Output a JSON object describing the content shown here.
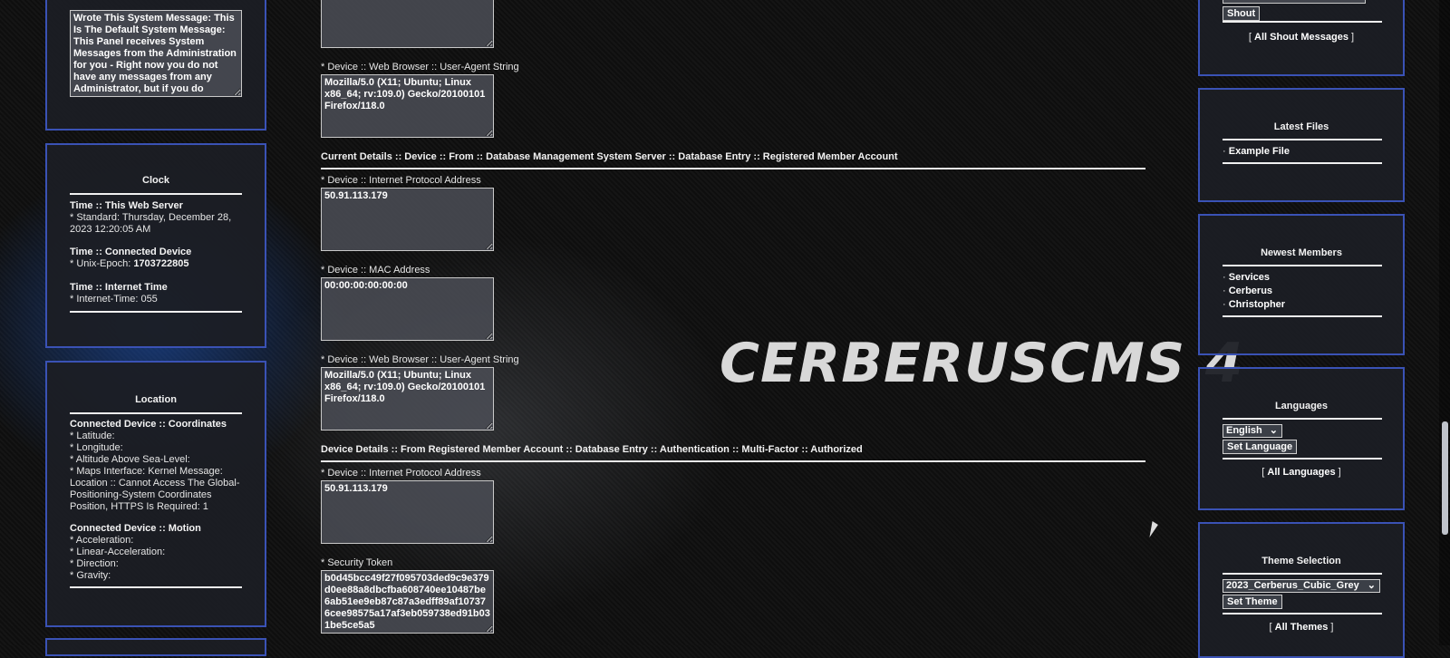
{
  "left": {
    "system_message_text": "Wrote This System Message: This Is The Default System Message: This Panel receives System Messages from the Administration for you - Right now you do not have any messages from any Administrator, but if you do",
    "clock": {
      "title": "Clock",
      "server_heading": "Time :: This Web Server",
      "server_value": "* Standard: Thursday, December 28, 2023 12:20:05 AM",
      "device_heading": "Time :: Connected Device",
      "device_label": "* Unix-Epoch: ",
      "device_value": "1703722805",
      "internet_heading": "Time :: Internet Time",
      "internet_value": "* Internet-Time: 055"
    },
    "location": {
      "title": "Location",
      "coords_heading": "Connected Device :: Coordinates",
      "latitude": "* Latitude:",
      "longitude": "* Longitude:",
      "altitude": "* Altitude Above Sea-Level:",
      "maps_message": "* Maps Interface: Kernel Message: Location :: Cannot Access The Global-Positioning-System Coordinates Position, HTTPS Is Required: 1",
      "motion_heading": "Connected Device :: Motion",
      "acceleration": "* Acceleration:",
      "linear_acceleration": "* Linear-Acceleration:",
      "direction": "* Direction:",
      "gravity": "* Gravity:"
    }
  },
  "main": {
    "ua_label_1": "* Device :: Web Browser :: User-Agent String",
    "ua_value_1": "Mozilla/5.0 (X11; Ubuntu; Linux x86_64; rv:109.0) Gecko/20100101 Firefox/118.0",
    "current_heading": "Current Details :: Device :: From :: Database Management System Server :: Database Entry :: Registered Member Account",
    "ip_label_1": "* Device :: Internet Protocol Address",
    "ip_value_1": "50.91.113.179",
    "mac_label": "* Device :: MAC Address",
    "mac_value": "00:00:00:00:00:00",
    "ua_label_2": "* Device :: Web Browser :: User-Agent String",
    "ua_value_2": "Mozilla/5.0 (X11; Ubuntu; Linux x86_64; rv:109.0) Gecko/20100101 Firefox/118.0",
    "auth_heading": "Device Details :: From Registered Member Account :: Database Entry :: Authentication :: Multi-Factor :: Authorized",
    "ip_label_2": "* Device :: Internet Protocol Address",
    "ip_value_2": "50.91.113.179",
    "token_label": "* Security Token",
    "token_value": "b0d45bcc49f27f095703ded9c9e379d0ee88a8dbcfba608740ee10487be6ab51ee9eb87c87a3edff89af107376cee98575a17af3eb059738ed91b031be5ce5a5",
    "logo_text": "CERBERUSCMS 4"
  },
  "right": {
    "shout_button": "Shout",
    "all_shouts": "All Shout Messages",
    "files": {
      "title": "Latest Files",
      "items": [
        "Example File"
      ]
    },
    "members": {
      "title": "Newest Members",
      "items": [
        "Services",
        "Cerberus",
        "Christopher"
      ]
    },
    "languages": {
      "title": "Languages",
      "selected": "English",
      "button": "Set Language",
      "all": "All Languages"
    },
    "themes": {
      "title": "Theme Selection",
      "selected": "2023_Cerberus_Cubic_Grey",
      "button": "Set Theme",
      "all": "All Themes"
    },
    "bullet": "·",
    "bracket_open": "[",
    "bracket_close": "]"
  },
  "colors": {
    "panel_border": "#3a52b5",
    "panel_bg": "#1c1e24"
  }
}
